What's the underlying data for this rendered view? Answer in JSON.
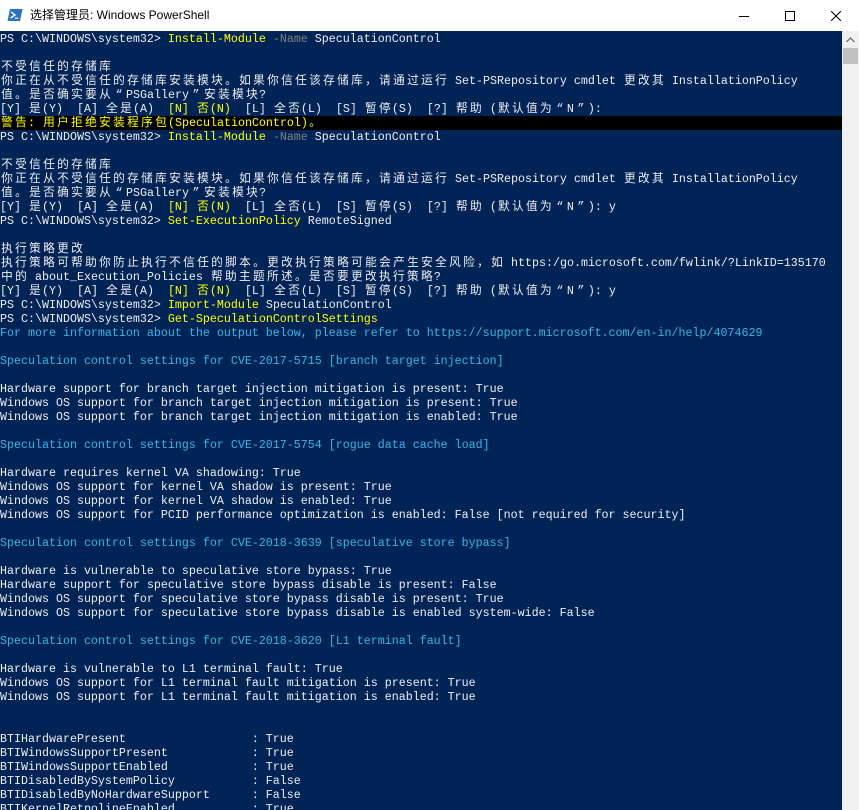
{
  "window": {
    "title": "选择管理员: Windows PowerShell",
    "app_icon": "powershell-icon",
    "controls": [
      {
        "icon": "minimize-icon"
      },
      {
        "icon": "maximize-icon"
      },
      {
        "icon": "close-icon"
      }
    ]
  },
  "scrollbar": {
    "up_icon": "chevron-up-icon"
  },
  "colors": {
    "console_background": "#012456",
    "default": "#EEEDF0",
    "yellow": "#FFFF00",
    "gray": "#808080",
    "cyan": "#3BB4E6",
    "black": "#000000",
    "title_bar": "#FFFFFF",
    "title_text": "#000000",
    "scrollbar_track": "#F0F0F0",
    "scrollbar_thumb": "#C1C1C1",
    "scrollbar_arrow": "#606060"
  },
  "console": {
    "lines": [
      {
        "segments": [
          {
            "text": "PS C:\\WINDOWS\\system32> "
          },
          {
            "text": "Install-Module",
            "color": "yellow"
          },
          {
            "text": " -Name",
            "color": "gray"
          },
          {
            "text": " SpeculationControl"
          }
        ]
      },
      {
        "text": ""
      },
      {
        "text": "不受信任的存储库"
      },
      {
        "text": "你正在从不受信任的存储库安装模块。如果你信任该存储库，请通过运行 Set-PSRepository cmdlet 更改其 InstallationPolicy"
      },
      {
        "text": "值。是否确实要从“PSGallery”安装模块?"
      },
      {
        "segments": [
          {
            "text": "[Y] 是(Y)  [A] 全是(A)  "
          },
          {
            "text": "[N] 否(N)",
            "color": "yellow"
          },
          {
            "text": "  [L] 全否(L)  [S] 暂停(S)  [?] 帮助 (默认值为“N”):"
          }
        ]
      },
      {
        "text": "警告: 用户拒绝安装程序包(SpeculationControl)。",
        "color": "yellow",
        "background": "black"
      },
      {
        "segments": [
          {
            "text": "PS C:\\WINDOWS\\system32> "
          },
          {
            "text": "Install-Module",
            "color": "yellow"
          },
          {
            "text": " -Name",
            "color": "gray"
          },
          {
            "text": " SpeculationControl"
          }
        ]
      },
      {
        "text": ""
      },
      {
        "text": "不受信任的存储库"
      },
      {
        "text": "你正在从不受信任的存储库安装模块。如果你信任该存储库，请通过运行 Set-PSRepository cmdlet 更改其 InstallationPolicy"
      },
      {
        "text": "值。是否确实要从“PSGallery”安装模块?"
      },
      {
        "segments": [
          {
            "text": "[Y] 是(Y)  [A] 全是(A)  "
          },
          {
            "text": "[N] 否(N)",
            "color": "yellow"
          },
          {
            "text": "  [L] 全否(L)  [S] 暂停(S)  [?] 帮助 (默认值为“N”): y"
          }
        ]
      },
      {
        "segments": [
          {
            "text": "PS C:\\WINDOWS\\system32> "
          },
          {
            "text": "Set-ExecutionPolicy",
            "color": "yellow"
          },
          {
            "text": " RemoteSigned"
          }
        ]
      },
      {
        "text": ""
      },
      {
        "text": "执行策略更改"
      },
      {
        "text": "执行策略可帮助你防止执行不信任的脚本。更改执行策略可能会产生安全风险，如 https:/go.microsoft.com/fwlink/?LinkID=135170"
      },
      {
        "text": "中的 about_Execution_Policies 帮助主题所述。是否要更改执行策略?"
      },
      {
        "segments": [
          {
            "text": "[Y] 是(Y)  [A] 全是(A)  "
          },
          {
            "text": "[N] 否(N)",
            "color": "yellow"
          },
          {
            "text": "  [L] 全否(L)  [S] 暂停(S)  [?] 帮助 (默认值为“N”): y"
          }
        ]
      },
      {
        "segments": [
          {
            "text": "PS C:\\WINDOWS\\system32> "
          },
          {
            "text": "Import-Module",
            "color": "yellow"
          },
          {
            "text": " SpeculationControl"
          }
        ]
      },
      {
        "segments": [
          {
            "text": "PS C:\\WINDOWS\\system32> "
          },
          {
            "text": "Get-SpeculationControlSettings",
            "color": "yellow"
          }
        ]
      },
      {
        "text": "For more information about the output below, please refer to https://support.microsoft.com/en-in/help/4074629",
        "color": "cyan"
      },
      {
        "text": ""
      },
      {
        "text": "Speculation control settings for CVE-2017-5715 [branch target injection]",
        "color": "cyan"
      },
      {
        "text": ""
      },
      {
        "text": "Hardware support for branch target injection mitigation is present: True"
      },
      {
        "text": "Windows OS support for branch target injection mitigation is present: True"
      },
      {
        "text": "Windows OS support for branch target injection mitigation is enabled: True"
      },
      {
        "text": ""
      },
      {
        "text": "Speculation control settings for CVE-2017-5754 [rogue data cache load]",
        "color": "cyan"
      },
      {
        "text": ""
      },
      {
        "text": "Hardware requires kernel VA shadowing: True"
      },
      {
        "text": "Windows OS support for kernel VA shadow is present: True"
      },
      {
        "text": "Windows OS support for kernel VA shadow is enabled: True"
      },
      {
        "text": "Windows OS support for PCID performance optimization is enabled: False [not required for security]"
      },
      {
        "text": ""
      },
      {
        "text": "Speculation control settings for CVE-2018-3639 [speculative store bypass]",
        "color": "cyan"
      },
      {
        "text": ""
      },
      {
        "text": "Hardware is vulnerable to speculative store bypass: True"
      },
      {
        "text": "Hardware support for speculative store bypass disable is present: False"
      },
      {
        "text": "Windows OS support for speculative store bypass disable is present: True"
      },
      {
        "text": "Windows OS support for speculative store bypass disable is enabled system-wide: False"
      },
      {
        "text": ""
      },
      {
        "text": "Speculation control settings for CVE-2018-3620 [L1 terminal fault]",
        "color": "cyan"
      },
      {
        "text": ""
      },
      {
        "text": "Hardware is vulnerable to L1 terminal fault: True"
      },
      {
        "text": "Windows OS support for L1 terminal fault mitigation is present: True"
      },
      {
        "text": "Windows OS support for L1 terminal fault mitigation is enabled: True"
      },
      {
        "text": ""
      },
      {
        "text": ""
      },
      {
        "text": "BTIHardwarePresent                  : True"
      },
      {
        "text": "BTIWindowsSupportPresent            : True"
      },
      {
        "text": "BTIWindowsSupportEnabled            : True"
      },
      {
        "text": "BTIDisabledBySystemPolicy           : False"
      },
      {
        "text": "BTIDisabledByNoHardwareSupport      : False"
      },
      {
        "text": "BTIKernelRetpolineEnabled           : True"
      }
    ]
  }
}
